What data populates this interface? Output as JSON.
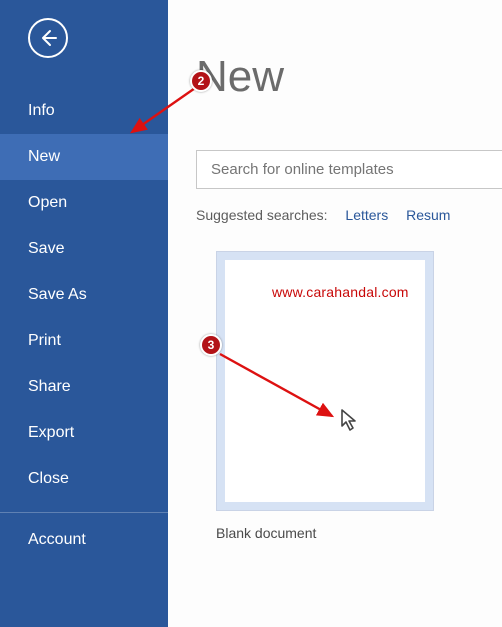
{
  "sidebar": {
    "items": [
      {
        "label": "Info"
      },
      {
        "label": "New"
      },
      {
        "label": "Open"
      },
      {
        "label": "Save"
      },
      {
        "label": "Save As"
      },
      {
        "label": "Print"
      },
      {
        "label": "Share"
      },
      {
        "label": "Export"
      },
      {
        "label": "Close"
      }
    ],
    "footer": [
      {
        "label": "Account"
      }
    ]
  },
  "main": {
    "title": "New",
    "search_placeholder": "Search for online templates",
    "suggested_label": "Suggested searches:",
    "suggested_links": [
      "Letters",
      "Resum"
    ],
    "templates": [
      {
        "label": "Blank document"
      }
    ]
  },
  "callouts": {
    "c2": "2",
    "c3": "3"
  },
  "watermark": "www.carahandal.com"
}
